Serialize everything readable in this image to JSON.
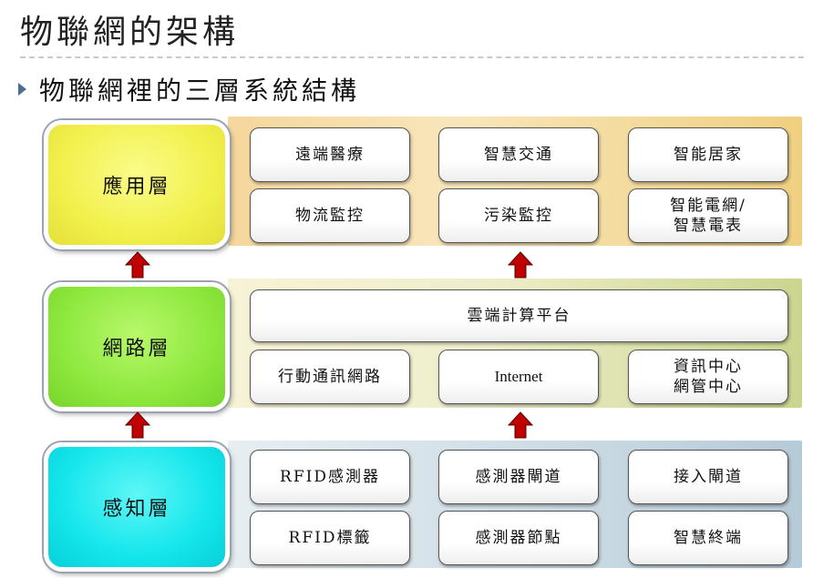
{
  "title": "物聯網的架構",
  "bullet": "物聯網裡的三層系統結構",
  "layers": {
    "application": {
      "label": "應用層",
      "nodes": [
        "遠端醫療",
        "智慧交通",
        "智能居家",
        "物流監控",
        "污染監控",
        "智能電網/\n智慧電表"
      ]
    },
    "network": {
      "label": "網路層",
      "platform": "雲端計算平台",
      "nodes": [
        "行動通訊網路",
        "Internet",
        "資訊中心\n網管中心"
      ]
    },
    "perception": {
      "label": "感知層",
      "nodes": [
        "RFID感測器",
        "感測器閘道",
        "接入閘道",
        "RFID標籤",
        "感測器節點",
        "智慧終端"
      ]
    }
  },
  "colors": {
    "application_layer": "#f2f04c",
    "network_layer": "#8ee83e",
    "perception_layer": "#14e6ec",
    "arrow": "#c00000"
  }
}
